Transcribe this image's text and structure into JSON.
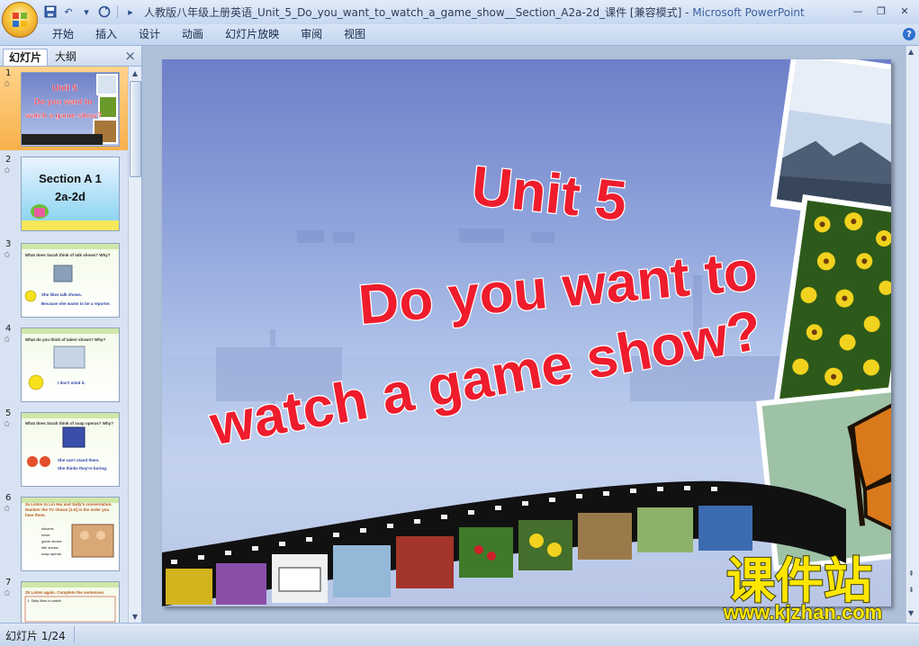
{
  "window": {
    "title": "人教版八年级上册英语_Unit_5_Do_you_want_to_watch_a_game_show__Section_A2a-2d_课件 [兼容模式] - ",
    "app_name": "Microsoft PowerPoint"
  },
  "ribbon": {
    "tabs": [
      "开始",
      "插入",
      "设计",
      "动画",
      "幻灯片放映",
      "审阅",
      "视图"
    ]
  },
  "pane": {
    "tab_slides": "幻灯片",
    "tab_outline": "大纲",
    "close": "×"
  },
  "thumbnails": [
    {
      "num": "1",
      "lines": [
        "Unit 5",
        "Do you want to",
        "watch a game show?"
      ]
    },
    {
      "num": "2",
      "lines": [
        "Section A 1",
        "2a-2d"
      ]
    },
    {
      "num": "3",
      "lines": [
        "What does Sarah think of talk shows? Why?",
        "She likes talk shows.",
        "Because she wants to be a reporter."
      ]
    },
    {
      "num": "4",
      "lines": [
        "What do you think of talent shows? Why?",
        "I don't mind it."
      ]
    },
    {
      "num": "5",
      "lines": [
        "What does Sarah think of soap operas? Why?",
        "She can't stand them.",
        "She thinks they're boring."
      ]
    },
    {
      "num": "6",
      "lines": [
        "2a Listen to Lin Hui and Sally's conversation. Number the TV shows [1-5] in the order you hear them.",
        "sitcoms",
        "news",
        "game shows",
        "talk shows",
        "soap operas"
      ]
    },
    {
      "num": "7",
      "lines": [
        "2b Listen again. Complete the sentences.",
        "1. Sally likes to watch"
      ]
    }
  ],
  "slide": {
    "title_line1": "Unit 5",
    "title_line2": "Do you want to",
    "title_line3": "watch a game show?"
  },
  "status": {
    "slide_indicator": "幻灯片 1/24"
  },
  "watermark": {
    "cn": "课件站",
    "url": "www.kjzhan.com"
  },
  "colors": {
    "title_text": "#ee1c2c",
    "title_stroke": "#ffffff",
    "watermark_yellow": "#ffe600",
    "selected_thumb": "#f8b04b"
  }
}
